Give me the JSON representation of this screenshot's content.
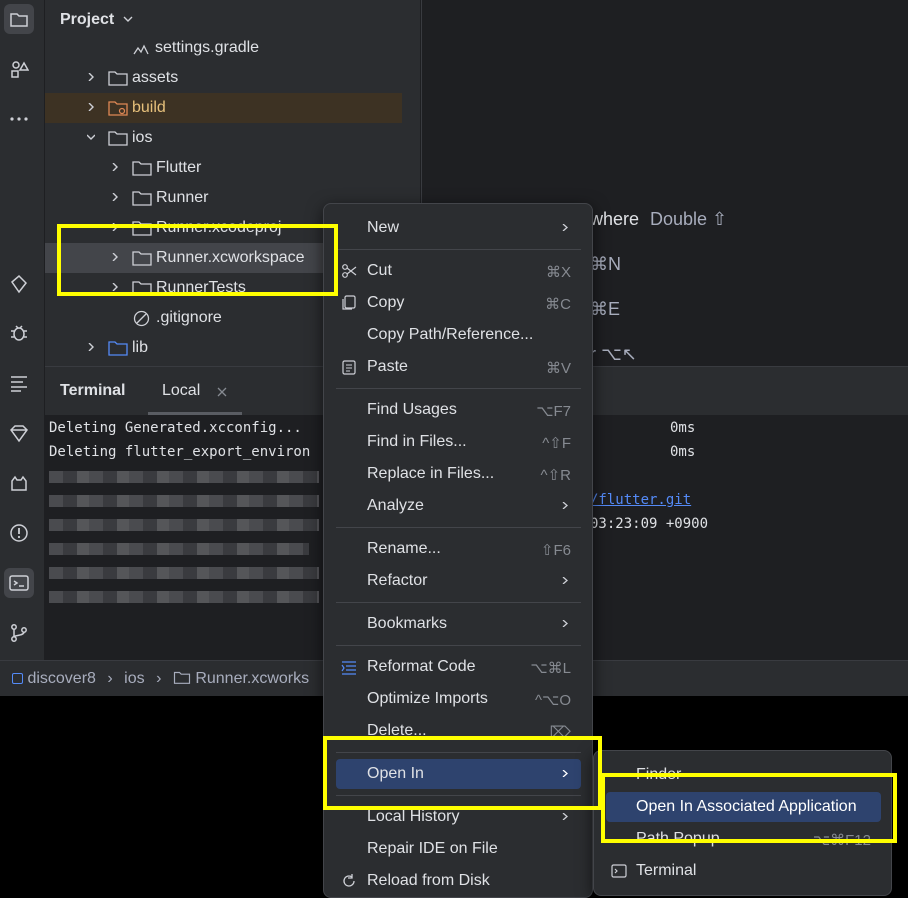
{
  "project_panel": {
    "title": "Project",
    "tree": [
      {
        "label": "settings.gradle"
      },
      {
        "label": "assets"
      },
      {
        "label": "build"
      },
      {
        "label": "ios"
      },
      {
        "label": "Flutter"
      },
      {
        "label": "Runner"
      },
      {
        "label": "Runner.xcodeproj"
      },
      {
        "label": "Runner.xcworkspace"
      },
      {
        "label": "RunnerTests"
      },
      {
        "label": ".gitignore"
      },
      {
        "label": "lib"
      }
    ]
  },
  "editor_hints": {
    "search_everywhere": "where",
    "search_shortcut": "Double ⇧",
    "hint2": "⌘N",
    "hint3": "⌘E",
    "hint4": "r  ⌥↖"
  },
  "terminal": {
    "title": "Terminal",
    "tab": "Local",
    "lines": [
      {
        "text": "Deleting Generated.xcconfig...",
        "time": "0ms"
      },
      {
        "text": "Deleting flutter_export_environ",
        "time": "0ms"
      }
    ],
    "link_text": "/flutter.git",
    "date_text": "03:23:09 +0900"
  },
  "breadcrumb": {
    "items": [
      "discover8",
      "ios",
      "Runner.xcworks"
    ]
  },
  "context_menu": {
    "items": {
      "new": "New",
      "cut": "Cut",
      "cut_sc": "⌘X",
      "copy": "Copy",
      "copy_sc": "⌘C",
      "copy_path": "Copy Path/Reference...",
      "paste": "Paste",
      "paste_sc": "⌘V",
      "find_usages": "Find Usages",
      "find_usages_sc": "⌥F7",
      "find_in_files": "Find in Files...",
      "find_in_files_sc": "^⇧F",
      "replace_in_files": "Replace in Files...",
      "replace_in_files_sc": "^⇧R",
      "analyze": "Analyze",
      "rename": "Rename...",
      "rename_sc": "⇧F6",
      "refactor": "Refactor",
      "bookmarks": "Bookmarks",
      "reformat": "Reformat Code",
      "reformat_sc": "⌥⌘L",
      "optimize": "Optimize Imports",
      "optimize_sc": "^⌥O",
      "delete": "Delete...",
      "delete_sc": "⌦",
      "open_in": "Open In",
      "local_history": "Local History",
      "repair": "Repair IDE on File",
      "reload": "Reload from Disk"
    }
  },
  "submenu": {
    "finder": "Finder",
    "associated": "Open In Associated Application",
    "path_popup": "Path Popup",
    "path_popup_sc": "⌥⌘F12",
    "terminal": "Terminal"
  },
  "colors": {
    "highlight": "#ffff00",
    "selection": "#2e436e",
    "background": "#1e1f22"
  }
}
